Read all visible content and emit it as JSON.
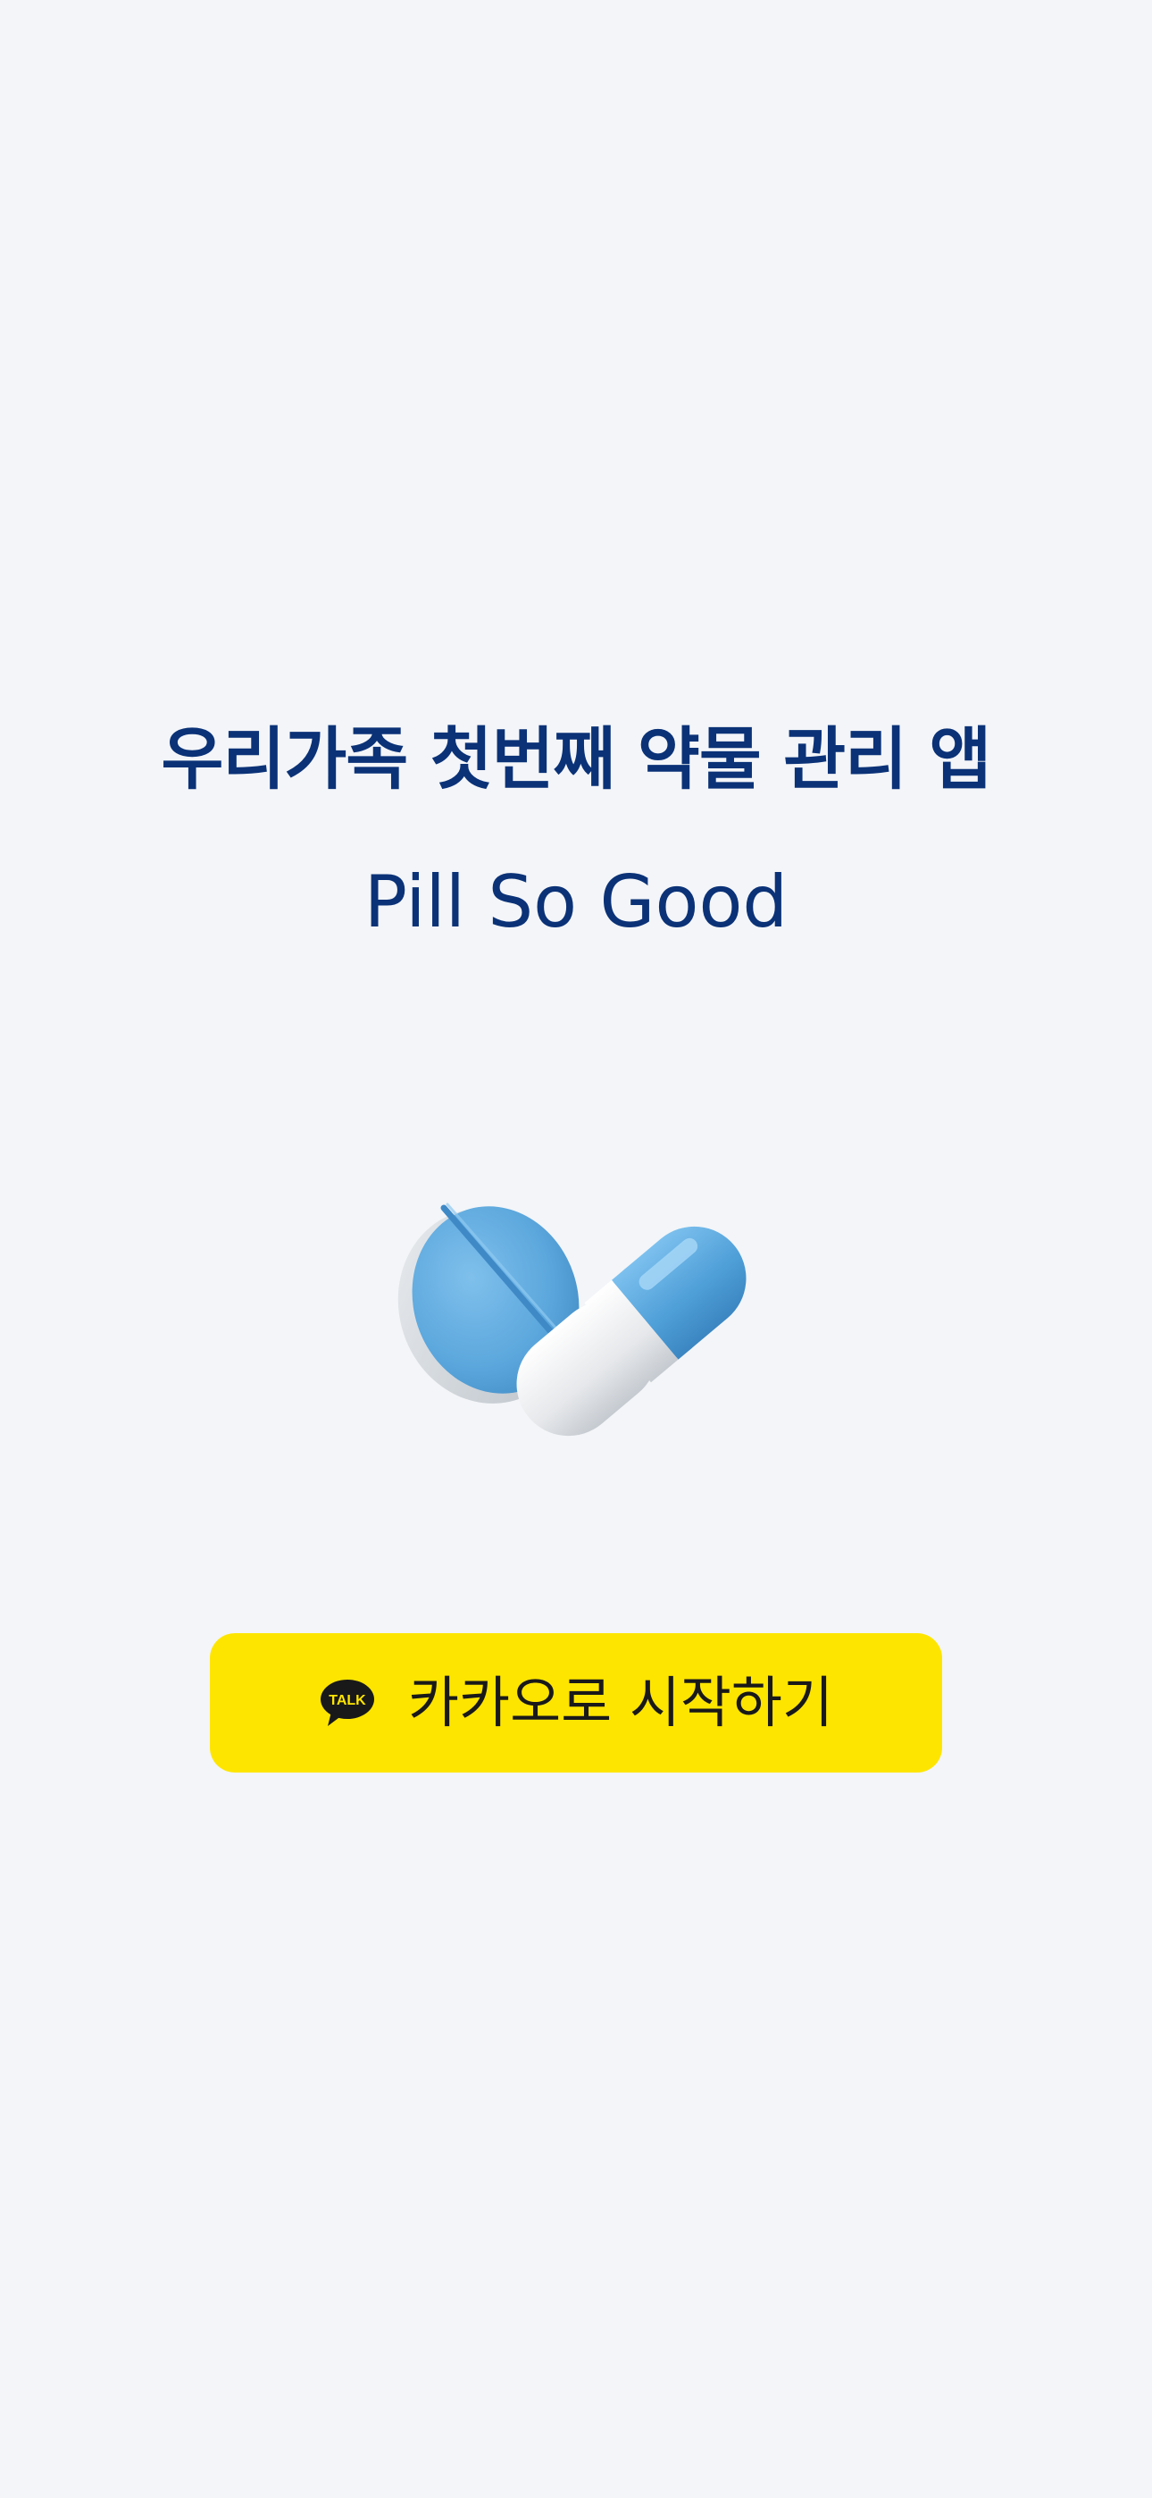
{
  "splash": {
    "tagline": "우리가족 첫번째 약물 관리 앱",
    "app_name": "Pill So Good",
    "illustration_icon": "pill-capsule-icon"
  },
  "login": {
    "kakao_button_label": "카카오로 시작하기",
    "kakao_icon": "kakao-talk-icon",
    "kakao_icon_text": "TALK"
  },
  "colors": {
    "background": "#f3f5f8",
    "title_text": "#0b3277",
    "kakao_yellow": "#fee500",
    "pill_blue": "#5aa6dc"
  }
}
